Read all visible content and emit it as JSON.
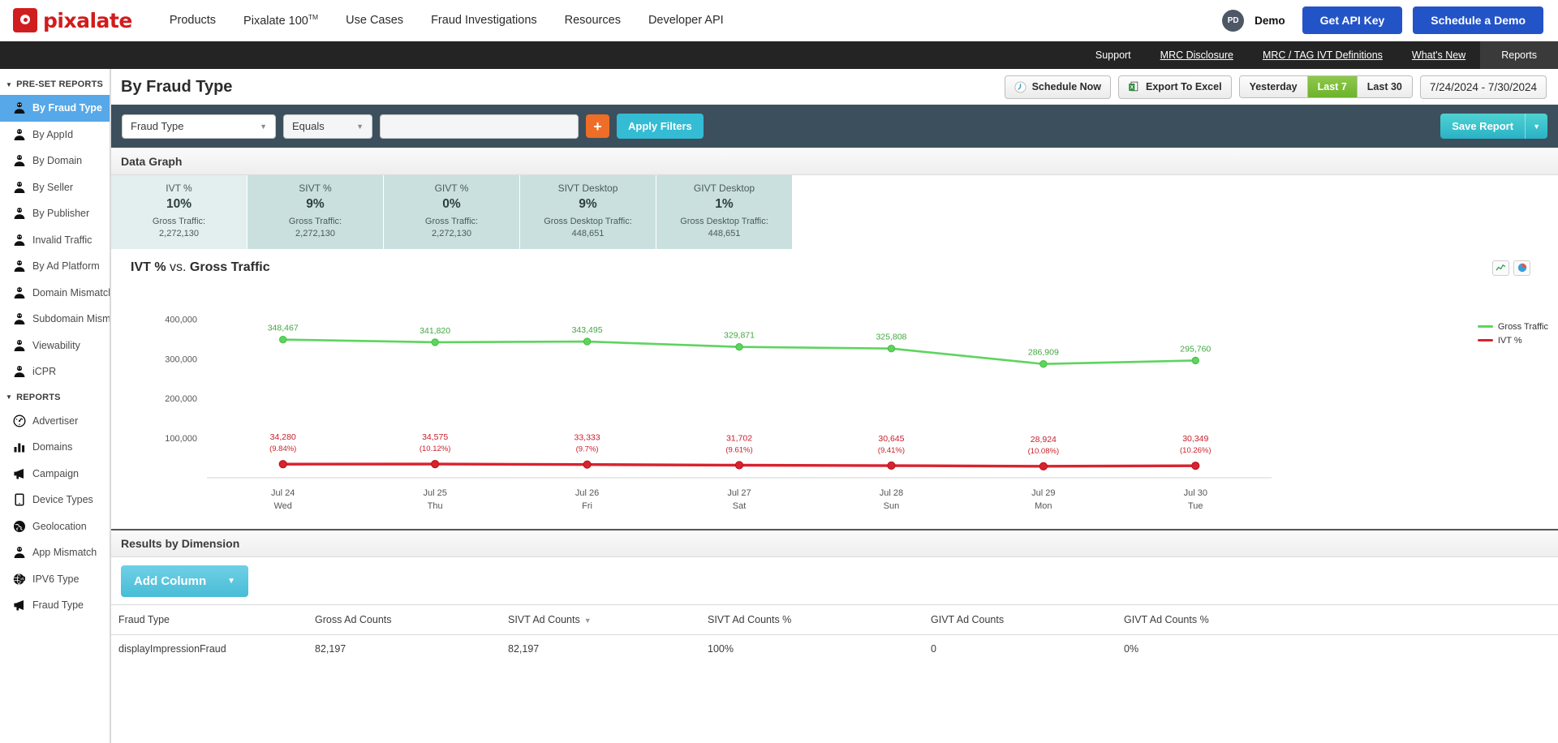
{
  "topnav": {
    "brand": "pixalate",
    "links": [
      {
        "label": "Products",
        "sup": ""
      },
      {
        "label": "Pixalate 100",
        "sup": "TM"
      },
      {
        "label": "Use Cases",
        "sup": ""
      },
      {
        "label": "Fraud Investigations",
        "sup": ""
      },
      {
        "label": "Resources",
        "sup": ""
      },
      {
        "label": "Developer API",
        "sup": ""
      }
    ],
    "avatar_initials": "PD",
    "user_name": "Demo",
    "get_api_key": "Get API Key",
    "schedule_demo": "Schedule a Demo"
  },
  "subnav": {
    "items": [
      {
        "label": "Support",
        "style": "plain"
      },
      {
        "label": "MRC Disclosure",
        "style": "underlined"
      },
      {
        "label": "MRC / TAG IVT Definitions",
        "style": "underlined"
      },
      {
        "label": "What's New",
        "style": "underlined"
      },
      {
        "label": "Reports",
        "style": "active"
      }
    ]
  },
  "sidebar": {
    "group1_title": "PRE-SET REPORTS",
    "group1_items": [
      {
        "label": "By Fraud Type",
        "icon": "person-icon",
        "active": true
      },
      {
        "label": "By AppId",
        "icon": "person-icon",
        "active": false
      },
      {
        "label": "By Domain",
        "icon": "person-icon",
        "active": false
      },
      {
        "label": "By Seller",
        "icon": "person-icon",
        "active": false
      },
      {
        "label": "By Publisher",
        "icon": "person-icon",
        "active": false
      },
      {
        "label": "Invalid Traffic",
        "icon": "person-icon",
        "active": false
      },
      {
        "label": "By Ad Platform",
        "icon": "person-icon",
        "active": false
      },
      {
        "label": "Domain Mismatch",
        "icon": "person-icon",
        "active": false
      },
      {
        "label": "Subdomain Mismatch",
        "icon": "person-icon",
        "active": false
      },
      {
        "label": "Viewability",
        "icon": "person-icon",
        "active": false
      },
      {
        "label": "iCPR",
        "icon": "person-icon",
        "active": false
      }
    ],
    "group2_title": "REPORTS",
    "group2_items": [
      {
        "label": "Advertiser",
        "icon": "gauge-icon"
      },
      {
        "label": "Domains",
        "icon": "bar-chart-icon"
      },
      {
        "label": "Campaign",
        "icon": "megaphone-icon"
      },
      {
        "label": "Device Types",
        "icon": "tablet-icon"
      },
      {
        "label": "Geolocation",
        "icon": "globe-icon"
      },
      {
        "label": "App Mismatch",
        "icon": "person-icon"
      },
      {
        "label": "IPV6 Type",
        "icon": "ipv6-globe-icon"
      },
      {
        "label": "Fraud Type",
        "icon": "megaphone-icon"
      }
    ]
  },
  "page": {
    "title": "By Fraud Type",
    "schedule_now": "Schedule Now",
    "export_to_excel": "Export To Excel",
    "range_buttons": [
      {
        "label": "Yesterday",
        "active": false
      },
      {
        "label": "Last 7",
        "active": true
      },
      {
        "label": "Last 30",
        "active": false
      }
    ],
    "date_range": "7/24/2024 - 7/30/2024"
  },
  "filterbar": {
    "dimension_value": "Fraud Type",
    "operator_value": "Equals",
    "value_input": "",
    "value_placeholder": "",
    "add_button": "+",
    "apply_filters": "Apply Filters",
    "save_report": "Save Report"
  },
  "data_graph": {
    "panel_title": "Data Graph",
    "kpis": [
      {
        "label": "IVT %",
        "value": "10%",
        "sub_label": "Gross Traffic:",
        "sub_value": "2,272,130"
      },
      {
        "label": "SIVT %",
        "value": "9%",
        "sub_label": "Gross Traffic:",
        "sub_value": "2,272,130"
      },
      {
        "label": "GIVT %",
        "value": "0%",
        "sub_label": "Gross Traffic:",
        "sub_value": "2,272,130"
      },
      {
        "label": "SIVT Desktop",
        "value": "9%",
        "sub_label": "Gross Desktop Traffic:",
        "sub_value": "448,651"
      },
      {
        "label": "GIVT Desktop",
        "value": "1%",
        "sub_label": "Gross Desktop Traffic:",
        "sub_value": "448,651"
      }
    ]
  },
  "chart_data": {
    "type": "line",
    "title_left": "IVT %",
    "title_mid": "vs.",
    "title_right": "Gross Traffic",
    "x": [
      "Jul 24",
      "Jul 25",
      "Jul 26",
      "Jul 27",
      "Jul 28",
      "Jul 29",
      "Jul 30"
    ],
    "x_sub": [
      "Wed",
      "Thu",
      "Fri",
      "Sat",
      "Sun",
      "Mon",
      "Tue"
    ],
    "ylim": [
      0,
      450000
    ],
    "yticks": [
      "400,000",
      "300,000",
      "200,000",
      "100,000"
    ],
    "ytick_values": [
      400000,
      300000,
      200000,
      100000
    ],
    "grid": false,
    "legend_position": "right",
    "series": [
      {
        "name": "Gross Traffic",
        "color": "#5ed45e",
        "values": [
          348467,
          341820,
          343495,
          329871,
          325808,
          286909,
          295760
        ],
        "labels": [
          "348,467",
          "341,820",
          "343,495",
          "329,871",
          "325,808",
          "286,909",
          "295,760"
        ]
      },
      {
        "name": "IVT %",
        "color": "#d8232f",
        "values": [
          34280,
          34575,
          33333,
          31702,
          30645,
          28924,
          30349
        ],
        "labels": [
          "34,280",
          "34,575",
          "33,333",
          "31,702",
          "30,645",
          "28,924",
          "30,349"
        ],
        "pct_labels": [
          "(9.84%)",
          "(10.12%)",
          "(9.7%)",
          "(9.61%)",
          "(9.41%)",
          "(10.08%)",
          "(10.26%)"
        ]
      }
    ],
    "toggle_icons": [
      "line-chart-icon",
      "pie-chart-icon"
    ]
  },
  "results": {
    "panel_title": "Results by Dimension",
    "add_column": "Add Column",
    "columns": [
      {
        "label": "Fraud Type",
        "sorted": false
      },
      {
        "label": "Gross Ad Counts",
        "sorted": false
      },
      {
        "label": "SIVT Ad Counts",
        "sorted": true
      },
      {
        "label": "SIVT Ad Counts %",
        "sorted": false
      },
      {
        "label": "GIVT Ad Counts",
        "sorted": false
      },
      {
        "label": "GIVT Ad Counts %",
        "sorted": false
      }
    ],
    "rows": [
      {
        "fraud_type": "displayImpressionFraud",
        "gross_ad_counts": "82,197",
        "sivt_ad_counts": "82,197",
        "sivt_ad_counts_pct": "100%",
        "givt_ad_counts": "0",
        "givt_ad_counts_pct": "0%"
      }
    ]
  }
}
